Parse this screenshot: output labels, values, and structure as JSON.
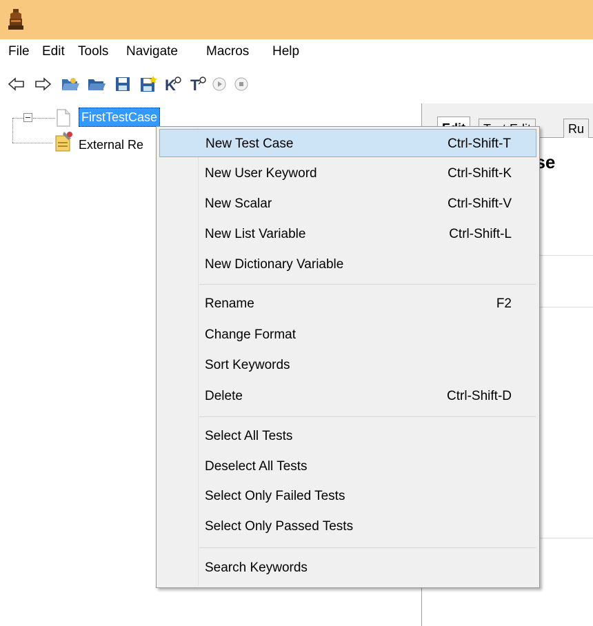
{
  "menubar": {
    "items": [
      "File",
      "Edit",
      "Tools",
      "Navigate",
      "Macros",
      "Help"
    ]
  },
  "toolbar": {
    "icons": [
      "back-arrow-icon",
      "forward-arrow-icon",
      "open-test-suite-icon",
      "open-directory-icon",
      "save-icon",
      "save-all-icon",
      "search-keywords-icon",
      "search-tests-icon",
      "run-icon",
      "stop-icon"
    ]
  },
  "tree": {
    "root_label": "FirstTestCase",
    "child_label": "External Re"
  },
  "editor": {
    "tabs": [
      "Edit",
      "Text Edit",
      "Ru"
    ],
    "title_fragment": "ase"
  },
  "context_menu": {
    "items": [
      {
        "label": "New Test Case",
        "shortcut": "Ctrl-Shift-T"
      },
      {
        "label": "New User Keyword",
        "shortcut": "Ctrl-Shift-K"
      },
      {
        "label": "New Scalar",
        "shortcut": "Ctrl-Shift-V"
      },
      {
        "label": "New List Variable",
        "shortcut": "Ctrl-Shift-L"
      },
      {
        "label": "New Dictionary Variable",
        "shortcut": ""
      },
      {
        "label": "Rename",
        "shortcut": "F2"
      },
      {
        "label": "Change Format",
        "shortcut": ""
      },
      {
        "label": "Sort Keywords",
        "shortcut": ""
      },
      {
        "label": "Delete",
        "shortcut": "Ctrl-Shift-D"
      },
      {
        "label": "Select All Tests",
        "shortcut": ""
      },
      {
        "label": "Deselect All Tests",
        "shortcut": ""
      },
      {
        "label": "Select Only Failed Tests",
        "shortcut": ""
      },
      {
        "label": "Select Only Passed Tests",
        "shortcut": ""
      },
      {
        "label": "Search Keywords",
        "shortcut": ""
      }
    ]
  },
  "colors": {
    "titlebar": "#f7c87e",
    "selection": "#3399ff",
    "menu_highlight": "#cde4f7"
  }
}
